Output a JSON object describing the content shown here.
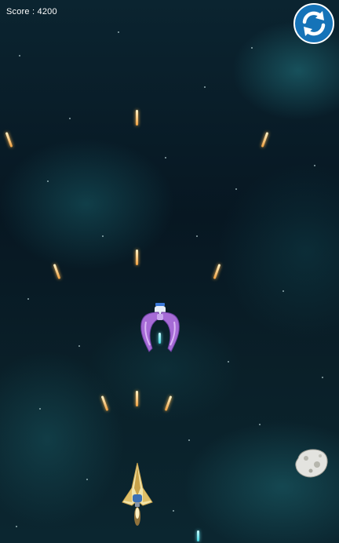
{
  "hud": {
    "score_label": "Score : 4200",
    "restart_icon": "refresh-icon"
  },
  "entities": {
    "player": "player-spaceship",
    "enemy": "enemy-spaceship",
    "asteroid": "asteroid",
    "player_bullet": "player-bullet",
    "enemy_bullet": "enemy-bullet"
  },
  "colors": {
    "restart_button": "#1573b8",
    "player_bullet": "#f0a040",
    "enemy_bullet": "#3fd4e0",
    "enemy_body": "#a66bd6"
  }
}
